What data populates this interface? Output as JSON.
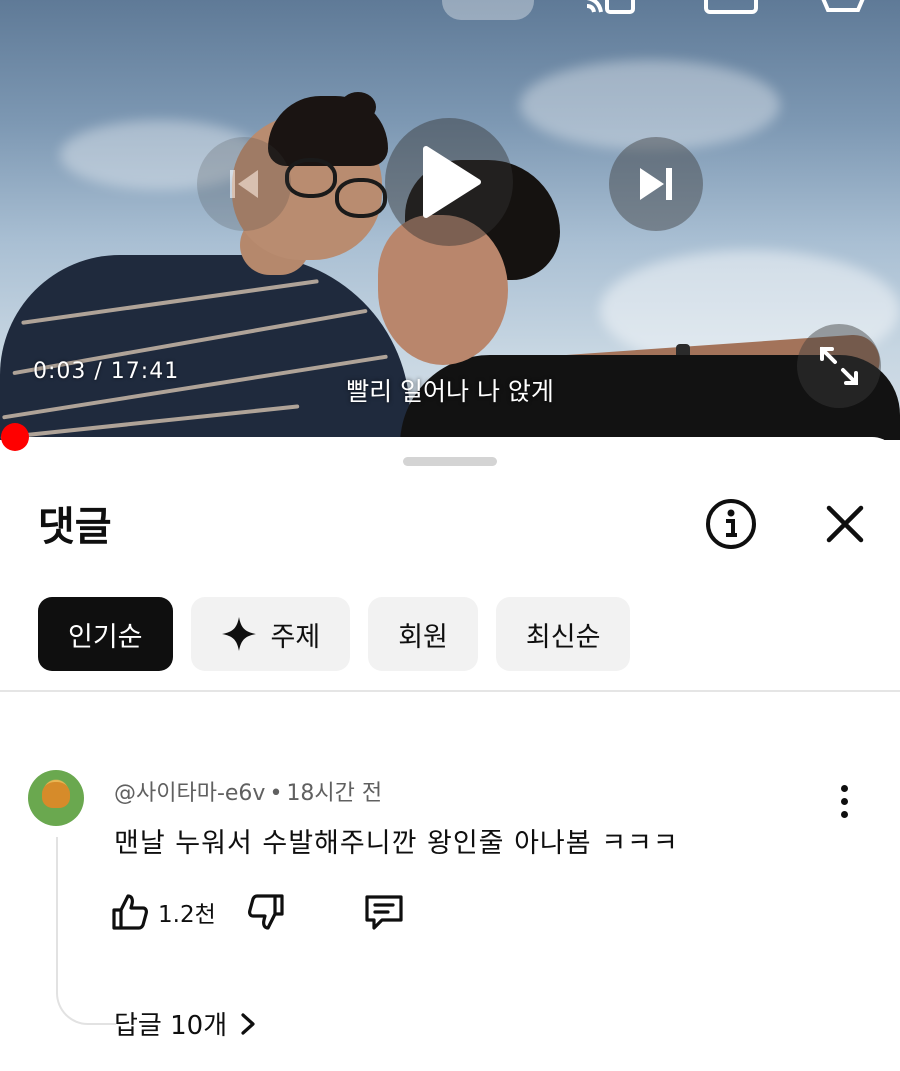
{
  "video": {
    "time_display": "0:03 / 17:41",
    "subtitle": "빨리 일어나 나 앉게",
    "progress_fraction": 0.0017
  },
  "comments_panel": {
    "title": "댓글",
    "filters": [
      {
        "label": "인기순",
        "active": true
      },
      {
        "label": "주제",
        "active": false,
        "icon": "sparkle-icon"
      },
      {
        "label": "회원",
        "active": false
      },
      {
        "label": "최신순",
        "active": false
      }
    ],
    "comment": {
      "author": "@사이타마-e6v",
      "separator": "•",
      "time_ago": "18시간 전",
      "text": "맨날 누워서 수발해주니깐 왕인줄 아나봄 ㅋㅋㅋ",
      "like_count": "1.2천",
      "replies_label": "답글 10개"
    }
  },
  "colors": {
    "accent_red": "#ff0000",
    "chip_active_bg": "#0f0f0f",
    "chip_bg": "#f2f2f2",
    "secondary_text": "#606060"
  }
}
